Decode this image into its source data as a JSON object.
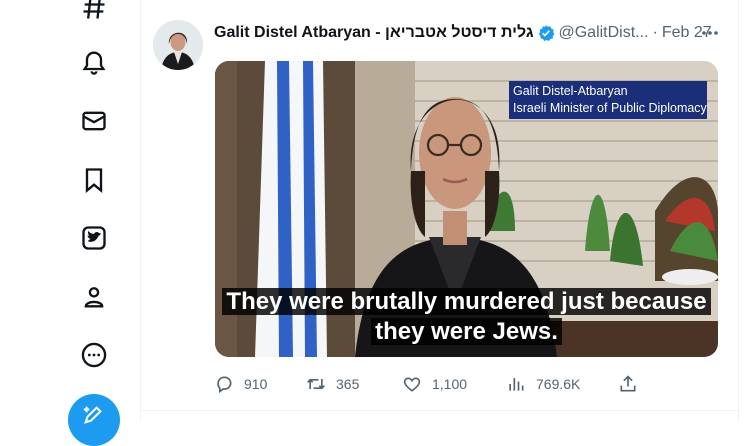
{
  "nav": {
    "items": [
      "hashtag-icon",
      "notifications-icon",
      "messages-icon",
      "bookmarks-icon",
      "twitter-blue-icon",
      "profile-icon",
      "more-options-icon"
    ],
    "compose_icon": "compose-tweet-icon"
  },
  "tweet": {
    "display_name": "Galit Distel Atbaryan - גלית דיסטל אטבריאן",
    "handle": "@GalitDist...",
    "separator": "·",
    "date": "Feb 27",
    "more_icon": "more-horizontal-icon",
    "verified_icon": "verified-badge-icon",
    "media": {
      "banner_line1": "Galit Distel-Atbaryan",
      "banner_line2": "Israeli Minister of Public Diplomacy",
      "caption_line1": "They were brutally murdered just because",
      "caption_line2": "they were Jews."
    },
    "actions": {
      "replies": "910",
      "retweets": "365",
      "likes": "1,100",
      "views": "769.6K",
      "share_icon": "share-icon"
    }
  },
  "colors": {
    "accent": "#1d9bf0",
    "text_secondary": "#536471",
    "banner_bg": "#1a2e7a"
  }
}
